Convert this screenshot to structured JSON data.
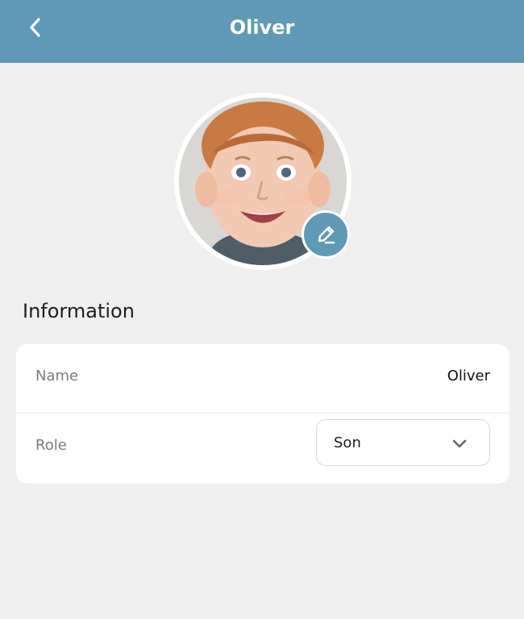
{
  "header": {
    "title": "Oliver",
    "back_icon": "chevron-left-icon",
    "background_color": "#5f99b5"
  },
  "profile": {
    "avatar_alt": "child portrait",
    "edit_icon": "pencil-icon"
  },
  "information": {
    "section_title": "Information",
    "name_label": "Name",
    "name_value": "Oliver",
    "role_label": "Role",
    "role_value": "Son",
    "role_dropdown_icon": "chevron-down-icon"
  }
}
